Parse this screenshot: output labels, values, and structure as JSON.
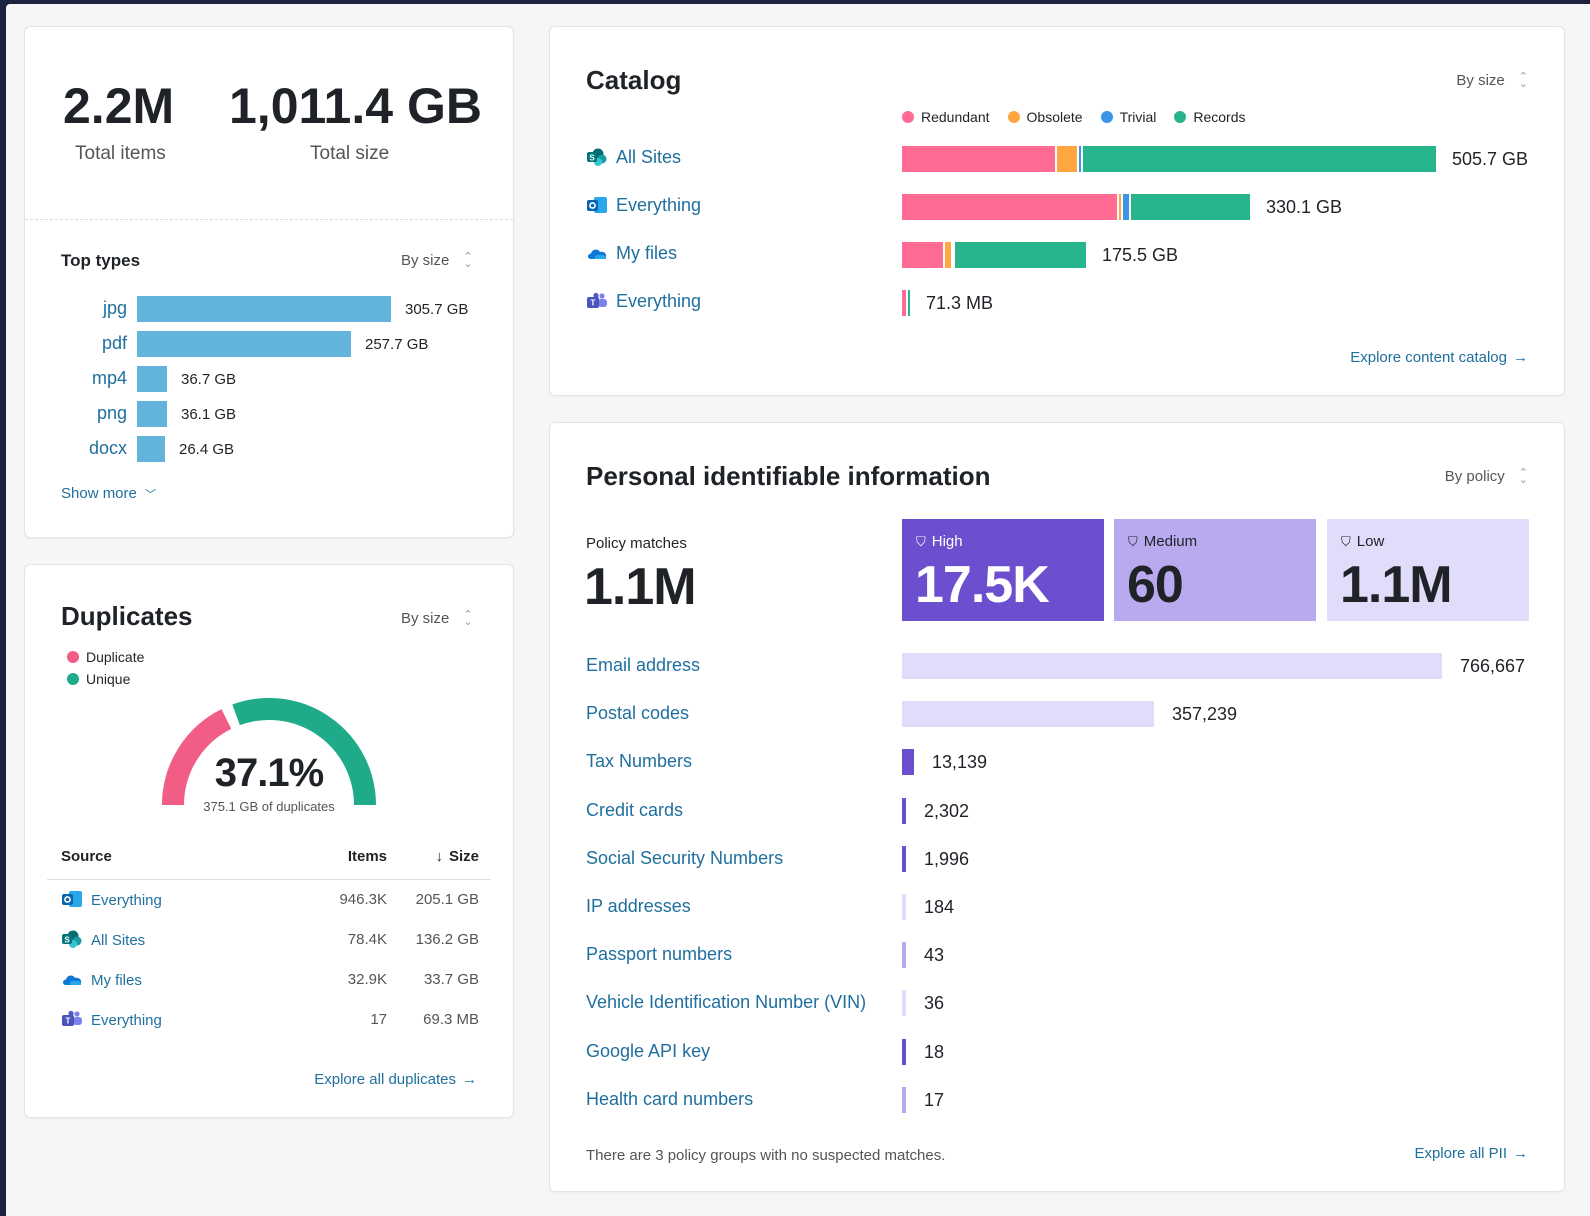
{
  "summary": {
    "total_items_value": "2.2M",
    "total_items_label": "Total items",
    "total_size_value": "1,011.4 GB",
    "total_size_label": "Total size"
  },
  "top_types": {
    "title": "Top types",
    "sort_label": "By size",
    "items": [
      {
        "label": "jpg",
        "value": "305.7 GB",
        "gb": 305.7
      },
      {
        "label": "pdf",
        "value": "257.7 GB",
        "gb": 257.7
      },
      {
        "label": "mp4",
        "value": "36.7 GB",
        "gb": 36.7
      },
      {
        "label": "png",
        "value": "36.1 GB",
        "gb": 36.1
      },
      {
        "label": "docx",
        "value": "26.4 GB",
        "gb": 26.4
      }
    ],
    "show_more": "Show more",
    "bar_color": "#62b4db"
  },
  "duplicates": {
    "title": "Duplicates",
    "sort_label": "By size",
    "legend": [
      {
        "label": "Duplicate",
        "color": "#f25d86"
      },
      {
        "label": "Unique",
        "color": "#1fab89"
      }
    ],
    "percent": "37.1%",
    "percent_fraction": 0.371,
    "caption": "375.1 GB of duplicates",
    "table": {
      "headers": {
        "source": "Source",
        "items": "Items",
        "size": "Size",
        "size_arrow": "↓"
      },
      "rows": [
        {
          "icon": "outlook-icon",
          "source": "Everything",
          "items": "946.3K",
          "size": "205.1 GB"
        },
        {
          "icon": "sharepoint-icon",
          "source": "All Sites",
          "items": "78.4K",
          "size": "136.2 GB"
        },
        {
          "icon": "onedrive-icon",
          "source": "My files",
          "items": "32.9K",
          "size": "33.7 GB"
        },
        {
          "icon": "teams-icon",
          "source": "Everything",
          "items": "17",
          "size": "69.3 MB"
        }
      ]
    },
    "explore_link": "Explore all duplicates",
    "arrow": "→"
  },
  "catalog": {
    "title": "Catalog",
    "sort_label": "By size",
    "legend": [
      {
        "label": "Redundant",
        "color": "#ff6b93"
      },
      {
        "label": "Obsolete",
        "color": "#ffa640"
      },
      {
        "label": "Trivial",
        "color": "#3b95e5"
      },
      {
        "label": "Records",
        "color": "#28b48c"
      }
    ],
    "rows": [
      {
        "icon": "sharepoint-icon",
        "label": "All Sites",
        "value": "505.7 GB",
        "gb": 505.7,
        "segments": {
          "redundant": 0.29,
          "obsolete": 0.04,
          "trivial": 0.008,
          "records": 0.662
        }
      },
      {
        "icon": "outlook-icon",
        "label": "Everything",
        "value": "330.1 GB",
        "gb": 330.1,
        "segments": {
          "redundant": 0.62,
          "obsolete": 0.01,
          "trivial": 0.025,
          "records": 0.345
        }
      },
      {
        "icon": "onedrive-icon",
        "label": "My files",
        "value": "175.5 GB",
        "gb": 175.5,
        "segments": {
          "redundant": 0.23,
          "obsolete": 0.045,
          "trivial": 0.01,
          "records": 0.715
        }
      },
      {
        "icon": "teams-icon",
        "label": "Everything",
        "value": "71.3 MB",
        "gb": 0.0713,
        "segments": {
          "redundant": 0.6,
          "obsolete": 0.0,
          "trivial": 0.0,
          "records": 0.4
        }
      }
    ],
    "explore_link": "Explore content catalog",
    "arrow": "→"
  },
  "pii": {
    "title": "Personal identifiable information",
    "sort_label": "By policy",
    "policy_matches_label": "Policy matches",
    "policy_matches_value": "1.1M",
    "levels": [
      {
        "label": "High",
        "value": "17.5K",
        "bg": "#6b4fce",
        "fg": "#ffffff"
      },
      {
        "label": "Medium",
        "value": "60",
        "bg": "#b9aaf0",
        "fg": "#1f2328"
      },
      {
        "label": "Low",
        "value": "1.1M",
        "bg": "#e2dcfb",
        "fg": "#1f2328"
      }
    ],
    "rows": [
      {
        "label": "Email address",
        "value": "766,667",
        "count": 766667,
        "level": "low"
      },
      {
        "label": "Postal codes",
        "value": "357,239",
        "count": 357239,
        "level": "low"
      },
      {
        "label": "Tax Numbers",
        "value": "13,139",
        "count": 13139,
        "level": "high"
      },
      {
        "label": "Credit cards",
        "value": "2,302",
        "count": 2302,
        "level": "high"
      },
      {
        "label": "Social Security Numbers",
        "value": "1,996",
        "count": 1996,
        "level": "high"
      },
      {
        "label": "IP addresses",
        "value": "184",
        "count": 184,
        "level": "low"
      },
      {
        "label": "Passport numbers",
        "value": "43",
        "count": 43,
        "level": "medium"
      },
      {
        "label": "Vehicle Identification Number (VIN)",
        "value": "36",
        "count": 36,
        "level": "low"
      },
      {
        "label": "Google API key",
        "value": "18",
        "count": 18,
        "level": "high"
      },
      {
        "label": "Health card numbers",
        "value": "17",
        "count": 17,
        "level": "medium"
      }
    ],
    "level_colors": {
      "high": "#6b4fce",
      "medium": "#b9aaf0",
      "low": "#e2dcfb"
    },
    "footer_note": "There are 3 policy groups with no suspected matches.",
    "explore_link": "Explore all PII",
    "arrow": "→"
  }
}
